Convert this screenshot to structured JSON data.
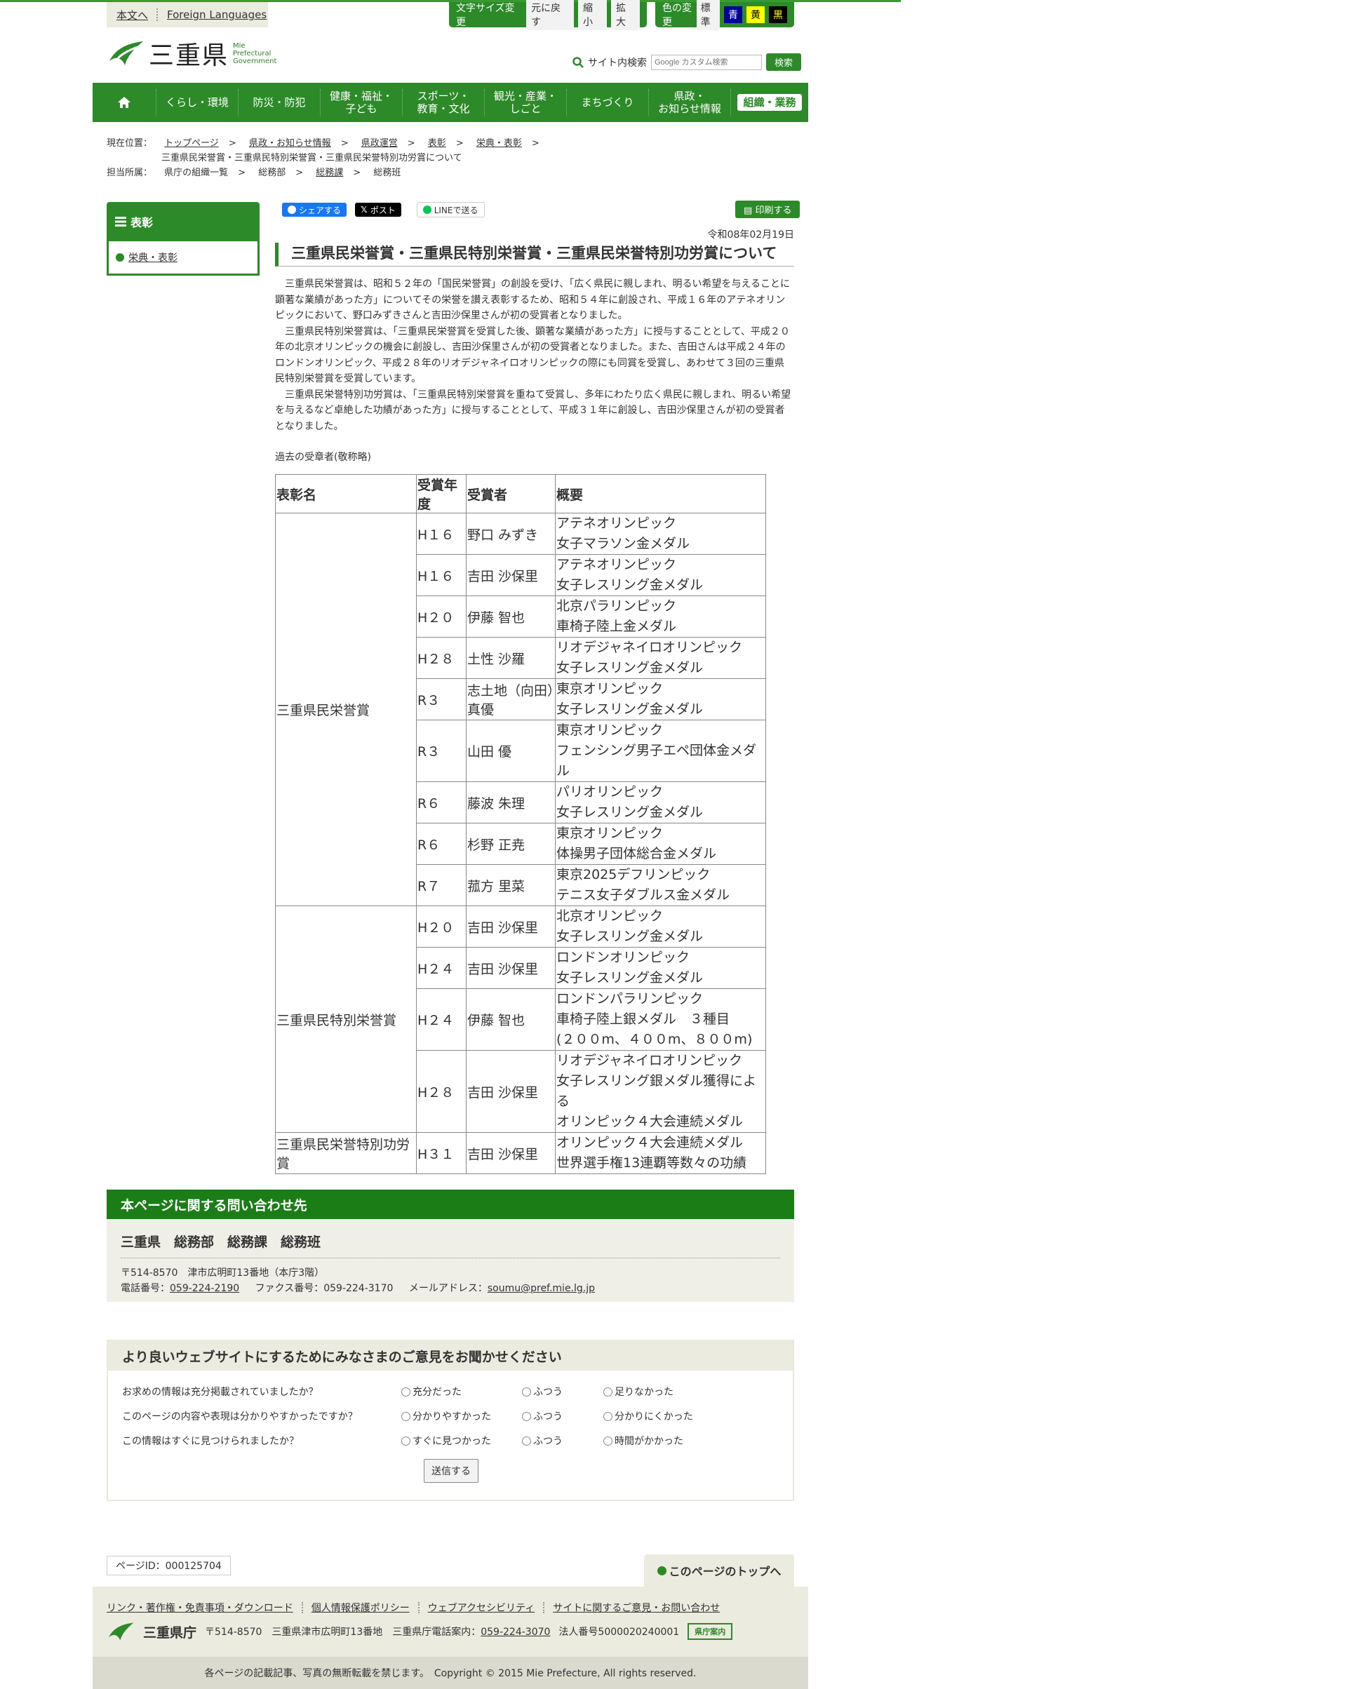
{
  "header": {
    "skip_label": "本文へ",
    "foreign_label": "Foreign Languages",
    "font_size_title": "文字サイズ変更",
    "font_size_buttons": [
      "元に戻す",
      "縮小",
      "拡大"
    ],
    "color_title": "色の変更",
    "color_buttons": [
      {
        "label": "標準",
        "bg": "#f2f2f2",
        "fg": "#333333"
      },
      {
        "label": "青",
        "bg": "#000099",
        "fg": "#ffffff"
      },
      {
        "label": "黄",
        "bg": "#ffff00",
        "fg": "#000000"
      },
      {
        "label": "黒",
        "bg": "#000000",
        "fg": "#ffff00"
      }
    ],
    "logo_jp": "三重県",
    "logo_en_1": "Mie",
    "logo_en_2": "Prefectural",
    "logo_en_3": "Government",
    "search_label": "サイト内検索",
    "search_placeholder": "Google カスタム検索",
    "search_button": "検索"
  },
  "nav": {
    "items": [
      "くらし・環境",
      "防災・防犯",
      "健康・福祉・\n子ども",
      "スポーツ・\n教育・文化",
      "観光・産業・\nしごと",
      "まちづくり",
      "県政・\nお知らせ情報"
    ],
    "special": "組織・業務"
  },
  "breadcrumb": {
    "label": "現在位置：",
    "items": [
      "トップページ",
      "県政・お知らせ情報",
      "県政運営",
      "表彰",
      "栄典・表彰"
    ],
    "current": "三重県民栄誉賞・三重県民特別栄誉賞・三重県民栄誉特別功労賞について",
    "dept_label": "担当所属：",
    "dept_items": [
      "県庁の組織一覧",
      "総務部",
      "総務課",
      "総務班"
    ]
  },
  "sidebar": {
    "heading": "表彰",
    "link": "栄典・表彰"
  },
  "share": {
    "facebook": "シェアする",
    "x": "ポスト",
    "line": "LINEで送る",
    "print": "印刷する"
  },
  "article": {
    "date": "令和08年02月19日",
    "title": "三重県民栄誉賞・三重県民特別栄誉賞・三重県民栄誉特別功労賞について",
    "paragraphs": [
      "三重県民栄誉賞は、昭和５２年の「国民栄誉賞」の創設を受け、「広く県民に親しまれ、明るい希望を与えることに顕著な業績があった方」についてその栄誉を讃え表彰するため、昭和５４年に創設され、平成１６年のアテネオリンピックにおいて、野口みずきさんと吉田沙保里さんが初の受賞者となりました。",
      "三重県民特別栄誉賞は、「三重県民栄誉賞を受賞した後、顕著な業績があった方」に授与することとして、平成２０年の北京オリンピックの機会に創設し、吉田沙保里さんが初の受賞者となりました。また、吉田さんは平成２４年のロンドンオリンピック、平成２８年のリオデジャネイロオリンピックの際にも同賞を受賞し、あわせて３回の三重県民特別栄誉賞を受賞しています。",
      "三重県民栄誉特別功労賞は、「三重県民特別栄誉賞を重ねて受賞し、多年にわたり広く県民に親しまれ、明るい希望を与えるなど卓絶した功績があった方」に授与することとして、平成３１年に創設し、吉田沙保里さんが初の受賞者となりました。"
    ],
    "past_label": "過去の受章者(敬称略)"
  },
  "awards_table": {
    "headers": [
      "表彰名",
      "受賞年度",
      "受賞者",
      "概要"
    ],
    "groups": [
      {
        "name": "三重県民栄誉賞",
        "rows": [
          {
            "year": "H１６",
            "person": "野口 みずき",
            "summary": [
              "アテネオリンピック",
              "女子マラソン金メダル"
            ]
          },
          {
            "year": "H１６",
            "person": "吉田 沙保里",
            "summary": [
              "アテネオリンピック",
              "女子レスリング金メダル"
            ]
          },
          {
            "year": "H２０",
            "person": "伊藤 智也",
            "summary": [
              "北京パラリンピック",
              "車椅子陸上金メダル"
            ]
          },
          {
            "year": "H２８",
            "person": "土性 沙羅",
            "summary": [
              "リオデジャネイロオリンピック",
              "女子レスリング金メダル"
            ]
          },
          {
            "year": "R３",
            "person": "志土地（向田）真優",
            "summary": [
              "東京オリンピック",
              "女子レスリング金メダル"
            ]
          },
          {
            "year": "R３",
            "person": "山田 優",
            "summary": [
              "東京オリンピック",
              "フェンシング男子エペ団体金メダル"
            ]
          },
          {
            "year": "R６",
            "person": "藤波 朱理",
            "summary": [
              "パリオリンピック",
              "女子レスリング金メダル"
            ]
          },
          {
            "year": "R６",
            "person": "杉野 正尭",
            "summary": [
              "東京オリンピック",
              "体操男子団体総合金メダル"
            ]
          },
          {
            "year": "R７",
            "person": "菰方 里菜",
            "summary": [
              "東京2025デフリンピック",
              "テニス女子ダブルス金メダル"
            ]
          }
        ]
      },
      {
        "name": "三重県民特別栄誉賞",
        "rows": [
          {
            "year": "H２０",
            "person": "吉田 沙保里",
            "summary": [
              "北京オリンピック",
              "女子レスリング金メダル"
            ]
          },
          {
            "year": "H２４",
            "person": "吉田 沙保里",
            "summary": [
              "ロンドンオリンピック",
              "女子レスリング金メダル"
            ]
          },
          {
            "year": "H２４",
            "person": "伊藤 智也",
            "summary": [
              "ロンドンパラリンピック",
              "車椅子陸上銀メダル　３種目",
              "(２００m、４００m、８００m)"
            ]
          },
          {
            "year": "H２８",
            "person": "吉田 沙保里",
            "summary": [
              "リオデジャネイロオリンピック",
              "女子レスリング銀メダル獲得による",
              "オリンピック４大会連続メダル"
            ]
          }
        ]
      },
      {
        "name": "三重県民栄誉特別功労賞",
        "rows": [
          {
            "year": "H３１",
            "person": "吉田 沙保里",
            "summary": [
              "オリンピック４大会連続メダル",
              "世界選手権13連覇等数々の功績"
            ]
          }
        ]
      }
    ]
  },
  "contact": {
    "heading": "本ページに関する問い合わせ先",
    "name": "三重県　総務部　総務課　総務班",
    "address": "〒514-8570　津市広明町13番地（本庁3階）",
    "tel_label": "電話番号：",
    "tel": "059-224-2190",
    "fax": "ファクス番号：059-224-3170",
    "mail_label": "メールアドレス：",
    "mail": "soumu@pref.mie.lg.jp"
  },
  "survey": {
    "heading": "より良いウェブサイトにするためにみなさまのご意見をお聞かせください",
    "questions": [
      {
        "q": "お求めの情報は充分掲載されていましたか？",
        "options": [
          "充分だった",
          "ふつう",
          "足りなかった"
        ]
      },
      {
        "q": "このページの内容や表現は分かりやすかったですか？",
        "options": [
          "分かりやすかった",
          "ふつう",
          "分かりにくかった"
        ]
      },
      {
        "q": "この情報はすぐに見つけられましたか？",
        "options": [
          "すぐに見つかった",
          "ふつう",
          "時間がかかった"
        ]
      }
    ],
    "submit": "送信する"
  },
  "page_id": "ページID：000125704",
  "to_top": "このページのトップへ",
  "footer": {
    "links": [
      "リンク・著作権・免責事項・ダウンロード",
      "個人情報保護ポリシー",
      "ウェブアクセシビリティ",
      "サイトに関するご意見・お問い合わせ"
    ],
    "org": "三重県庁",
    "address": "〒514-8570　三重県津市広明町13番地　三重県庁電話案内：",
    "tel": "059-224-3070",
    "corp": "法人番号5000020240001",
    "badge": "県庁案内",
    "copyright": "各ページの記載記事、写真の無断転載を禁じます。　Copyright © 2015 Mie Prefecture, All rights reserved."
  }
}
